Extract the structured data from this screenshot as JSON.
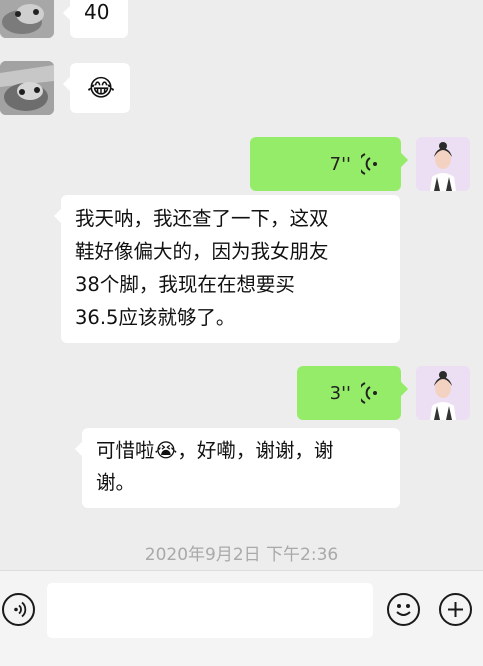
{
  "messages": [
    {
      "id": "m1",
      "side": "left",
      "type": "text",
      "text": "40"
    },
    {
      "id": "m2",
      "side": "left",
      "type": "emoji",
      "emoji": "😂"
    },
    {
      "id": "m3",
      "side": "right",
      "type": "voice",
      "duration": "7''"
    },
    {
      "id": "m4",
      "side": "left",
      "type": "text",
      "lines": [
        "我天呐，我还查了一下，这双",
        "鞋好像偏大的，因为我女朋友",
        "38个脚，我现在在想要买",
        "36.5应该就够了。"
      ]
    },
    {
      "id": "m5",
      "side": "right",
      "type": "voice",
      "duration": "3''"
    },
    {
      "id": "m6",
      "side": "left",
      "type": "text",
      "line1_prefix": "可惜啦",
      "line1_emoji": "😭",
      "line1_suffix": "，好嘞，谢谢，谢",
      "line2": "谢。"
    }
  ],
  "timestamp": "2020年9月2日 下午2:36",
  "input_bar": {
    "voice_icon": "voice-mode-icon",
    "emoji_icon": "emoji-icon",
    "plus_icon": "plus-icon"
  },
  "colors": {
    "background": "#ededed",
    "sent_bubble": "#95ec69",
    "received_bubble": "#ffffff",
    "timestamp": "#a9a9a9"
  }
}
